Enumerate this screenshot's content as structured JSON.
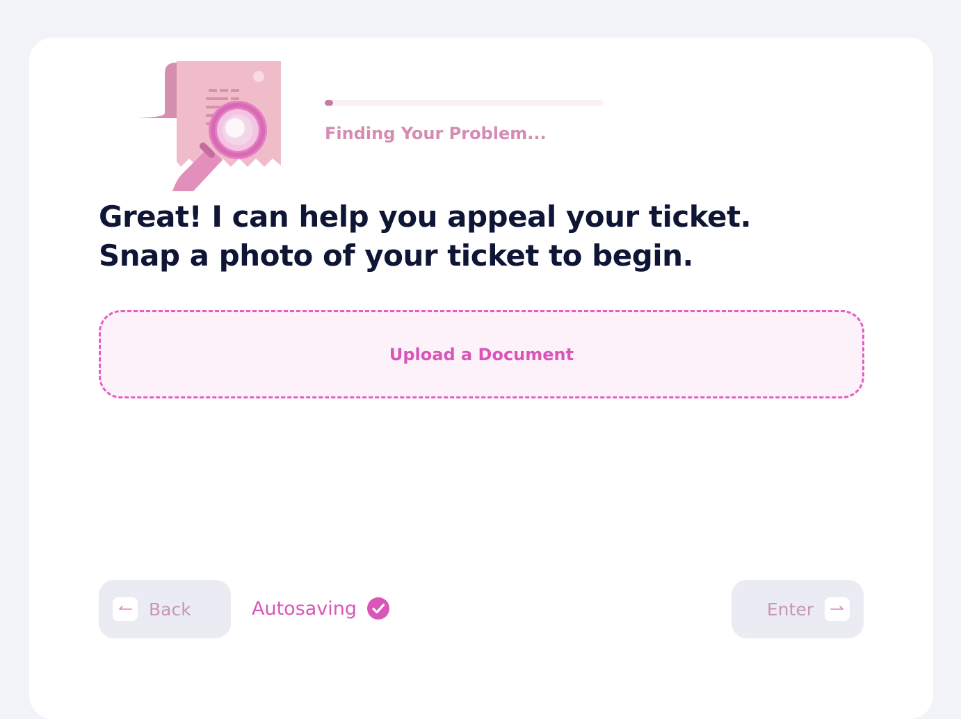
{
  "progress": {
    "label": "Finding Your Problem...",
    "value": 0.03
  },
  "headline": "Great! I can help you appeal your ticket. Snap a photo of your ticket to begin.",
  "upload": {
    "label": "Upload a Document"
  },
  "footer": {
    "back_label": "Back",
    "enter_label": "Enter",
    "autosave_label": "Autosaving"
  },
  "icons": {
    "illustration": "ticket-magnifier-illustration",
    "back_key": "arrow-left-icon",
    "enter_key": "arrow-right-icon",
    "autosave": "check-circle-icon"
  },
  "colors": {
    "accent": "#d956b8",
    "heading": "#0f1535",
    "progress_label": "#d58cb2",
    "button_bg": "#ebecf3",
    "page_bg": "#f1f3f9"
  }
}
